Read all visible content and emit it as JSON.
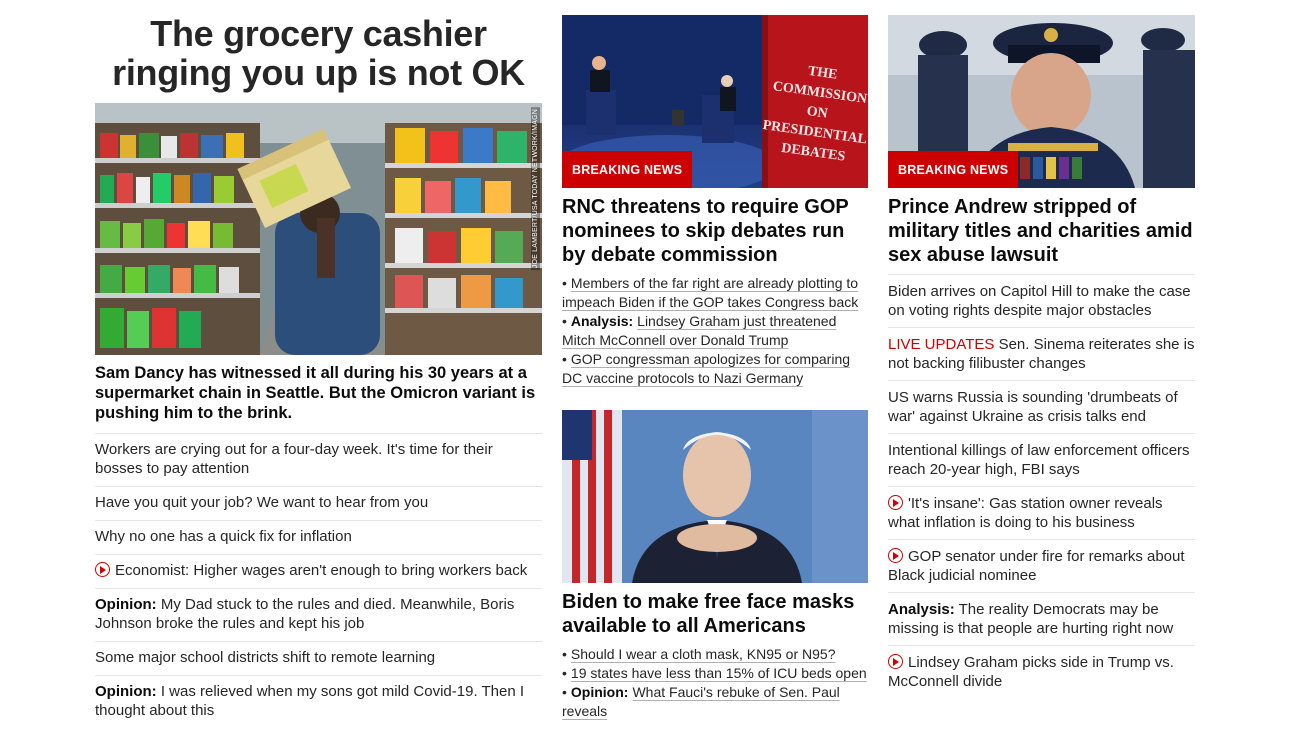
{
  "lead": {
    "title": "The grocery cashier ringing you up is not OK",
    "image_credit": "JOE LAMBERT/USA TODAY NETWORK/IMAGN",
    "subtitle": "Sam Dancy has witnessed it all during his 30 years at a supermarket chain in Seattle. But the Omicron variant is pushing him to the brink.",
    "links": [
      {
        "prefix": "",
        "text": "Workers are crying out for a four-day week. It's time for their bosses to pay attention",
        "video": false
      },
      {
        "prefix": "",
        "text": "Have you quit your job? We want to hear from you",
        "video": false
      },
      {
        "prefix": "",
        "text": "Why no one has a quick fix for inflation",
        "video": false
      },
      {
        "prefix": "",
        "text": "Economist: Higher wages aren't enough to bring workers back",
        "video": true
      },
      {
        "prefix": "Opinion:",
        "text": " My Dad stuck to the rules and died. Meanwhile, Boris Johnson broke the rules and kept his job",
        "video": false
      },
      {
        "prefix": "",
        "text": "Some major school districts shift to remote learning",
        "video": false
      },
      {
        "prefix": "Opinion:",
        "text": " I was relieved when my sons got mild Covid-19. Then I thought about this",
        "video": false
      }
    ]
  },
  "story_rnc": {
    "badge": "BREAKING NEWS",
    "sign_text": "THE COMMISSION ON PRESIDENTIAL DEBATES",
    "title": "RNC threatens to require GOP nominees to skip debates run by debate commission",
    "bullets": [
      {
        "prefix": "",
        "text": "Members of the far right are already plotting to impeach Biden if the GOP takes Congress back"
      },
      {
        "prefix": "Analysis:",
        "text": "Lindsey Graham just threatened Mitch McConnell over Donald Trump"
      },
      {
        "prefix": "",
        "text": "GOP congressman apologizes for comparing DC vaccine protocols to Nazi Germany"
      }
    ]
  },
  "story_biden": {
    "title": "Biden to make free face masks available to all Americans",
    "bullets": [
      {
        "prefix": "",
        "text": "Should I wear a cloth mask, KN95 or N95?"
      },
      {
        "prefix": "",
        "text": "19 states have less than 15% of ICU beds open"
      },
      {
        "prefix": "Opinion:",
        "text": "What Fauci's rebuke of Sen. Paul reveals"
      }
    ]
  },
  "story_andrew": {
    "badge": "BREAKING NEWS",
    "title": "Prince Andrew stripped of military titles and charities amid sex abuse lawsuit",
    "links": [
      {
        "prefix": "",
        "live": "",
        "text": "Biden arrives on Capitol Hill to make the case on voting rights despite major obstacles",
        "video": false
      },
      {
        "prefix": "",
        "live": "LIVE UPDATES",
        "text": " Sen. Sinema reiterates she is not backing filibuster changes",
        "video": false
      },
      {
        "prefix": "",
        "live": "",
        "text": "US warns Russia is sounding 'drumbeats of war' against Ukraine as crisis talks end",
        "video": false
      },
      {
        "prefix": "",
        "live": "",
        "text": "Intentional killings of law enforcement officers reach 20-year high, FBI says",
        "video": false
      },
      {
        "prefix": "",
        "live": "",
        "text": "'It's insane': Gas station owner reveals what inflation is doing to his business",
        "video": true
      },
      {
        "prefix": "",
        "live": "",
        "text": "GOP senator under fire for remarks about Black judicial nominee",
        "video": true
      },
      {
        "prefix": "Analysis:",
        "live": "",
        "text": " The reality Democrats may be missing is that people are hurting right now",
        "video": false
      },
      {
        "prefix": "",
        "live": "",
        "text": "Lindsey Graham picks side in Trump vs. McConnell divide",
        "video": true
      }
    ]
  },
  "colors": {
    "accent": "#cc0000",
    "text": "#262626",
    "divider": "#e6e6e6"
  }
}
